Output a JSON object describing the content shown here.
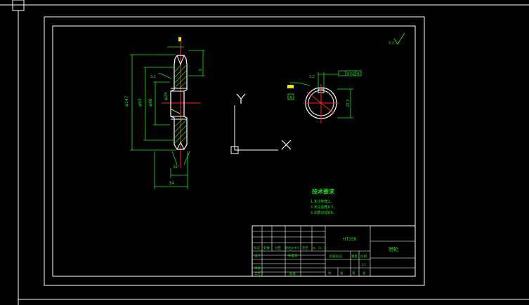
{
  "drawing": {
    "tech_requirements": {
      "title": "技术要求",
      "items": [
        "1.未注倒角1。",
        "2.未注圆角0.5。",
        "3.调质处理HB。"
      ]
    },
    "title_block": {
      "material": "HT150",
      "part_name": "带轮",
      "labels": [
        "标记",
        "处数",
        "分区",
        "更改文件号",
        "签名",
        "年、月、日"
      ],
      "row_labels": [
        "设计",
        "标准化",
        "审核",
        "工艺",
        "批准"
      ],
      "stage_labels": [
        "阶段标记",
        "重量",
        "比例"
      ],
      "scale": "1:1",
      "sheet_labels": [
        "共",
        "张",
        "第",
        "张"
      ]
    },
    "ucs": {
      "y_label": "Y",
      "x_label": "X"
    },
    "dims": {
      "outer_dia": "φ147",
      "inner_dia": "φ93",
      "bore_dia": "φ25",
      "hub_dia": "φ40",
      "width": "34",
      "angle": "34°",
      "keyway_depth": "28.3",
      "keyway_width": "8"
    },
    "tolerance": "0.02",
    "roughness": "3.2",
    "datum": "A"
  }
}
